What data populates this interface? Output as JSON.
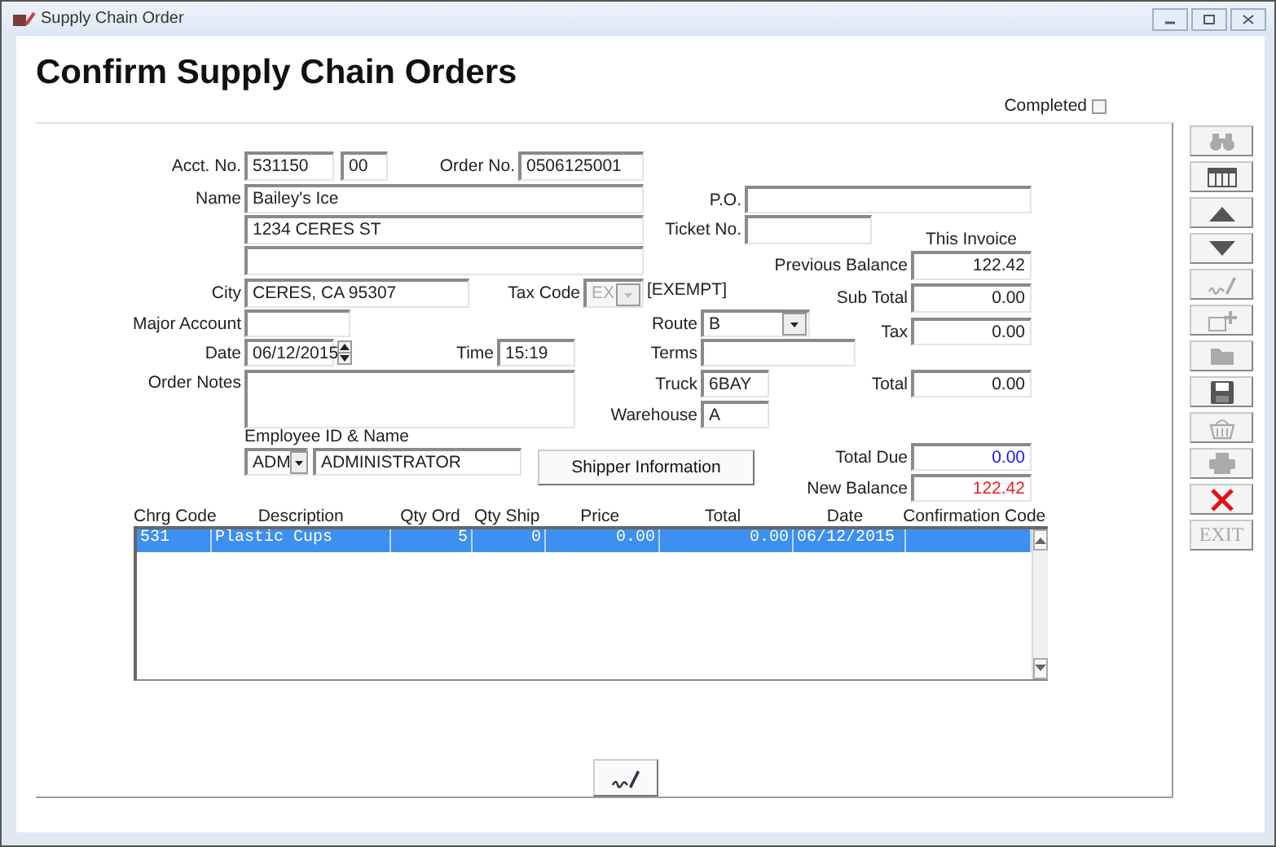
{
  "window": {
    "title": "Supply Chain Order"
  },
  "heading": "Confirm Supply Chain Orders",
  "completed": {
    "label": "Completed",
    "checked": false
  },
  "fields": [
    {
      "kind": "text",
      "label": "Acct. No.",
      "value": "531150"
    },
    {
      "kind": "text",
      "value": "00"
    },
    {
      "kind": "text",
      "label": "Order No.",
      "value": "0506125001"
    },
    {
      "kind": "text",
      "label": "Name",
      "value": "Bailey's Ice"
    },
    {
      "kind": "text",
      "value": "1234 CERES ST"
    },
    {
      "kind": "text"
    },
    {
      "kind": "text",
      "label": "City",
      "value": "CERES, CA  95307"
    },
    {
      "kind": "text",
      "label": "Major Account"
    },
    {
      "kind": "date",
      "label": "Date",
      "value": "06/12/2015"
    },
    {
      "kind": "text",
      "label": "Time",
      "value": "15:19"
    },
    {
      "kind": "textarea",
      "label": "Order Notes"
    },
    {
      "kind": "text",
      "label": "P.O."
    },
    {
      "kind": "text",
      "label": "Ticket No."
    },
    {
      "kind": "select",
      "label": "Tax Code",
      "value": "EX",
      "disabled": true,
      "note": "[EXEMPT]"
    },
    {
      "kind": "select",
      "label": "Route",
      "value": "B",
      "disabled": false
    },
    {
      "kind": "text",
      "label": "Terms"
    },
    {
      "kind": "text",
      "label": "Truck",
      "value": "6BAY"
    },
    {
      "kind": "text",
      "label": "Warehouse",
      "value": "A"
    },
    {
      "kind": "amount",
      "label": "Previous Balance",
      "value": "122.42"
    },
    {
      "kind": "amount",
      "label": "Sub Total",
      "value": "0.00"
    },
    {
      "kind": "amount",
      "label": "Tax",
      "value": "0.00"
    },
    {
      "kind": "amount",
      "label": "Total",
      "value": "0.00"
    },
    {
      "kind": "amount",
      "label": "Total Due",
      "value": "0.00",
      "color": "#1a1aff"
    },
    {
      "kind": "amount",
      "label": "New Balance",
      "value": "122.42",
      "color": "#e8202a"
    }
  ],
  "invoice_caption": "This Invoice",
  "employee": {
    "label": "Employee ID & Name",
    "id": "ADM",
    "name": "ADMINISTRATOR"
  },
  "shipper_button": "Shipper Information",
  "table": {
    "columns": [
      "Chrg Code",
      "Description",
      "Qty Ord",
      "Qty Ship",
      "Price",
      "Total",
      "Date",
      "Confirmation Code"
    ],
    "rows": [
      {
        "selected": true,
        "cells": [
          "531",
          "Plastic Cups",
          "5",
          "0",
          "0.00",
          "0.00",
          "06/12/2015"
        ]
      }
    ]
  },
  "toolbar": [
    {
      "kind": "find",
      "disabled": true
    },
    {
      "kind": "columns",
      "disabled": false
    },
    {
      "kind": "up",
      "disabled": false
    },
    {
      "kind": "down",
      "disabled": false
    },
    {
      "kind": "sign",
      "disabled": true
    },
    {
      "kind": "add",
      "disabled": true
    },
    {
      "kind": "folder",
      "disabled": true
    },
    {
      "kind": "save",
      "disabled": false
    },
    {
      "kind": "basket",
      "disabled": true
    },
    {
      "kind": "print",
      "disabled": true
    },
    {
      "kind": "delete",
      "disabled": false
    },
    {
      "kind": "exit",
      "label": "EXIT",
      "disabled": true
    }
  ]
}
